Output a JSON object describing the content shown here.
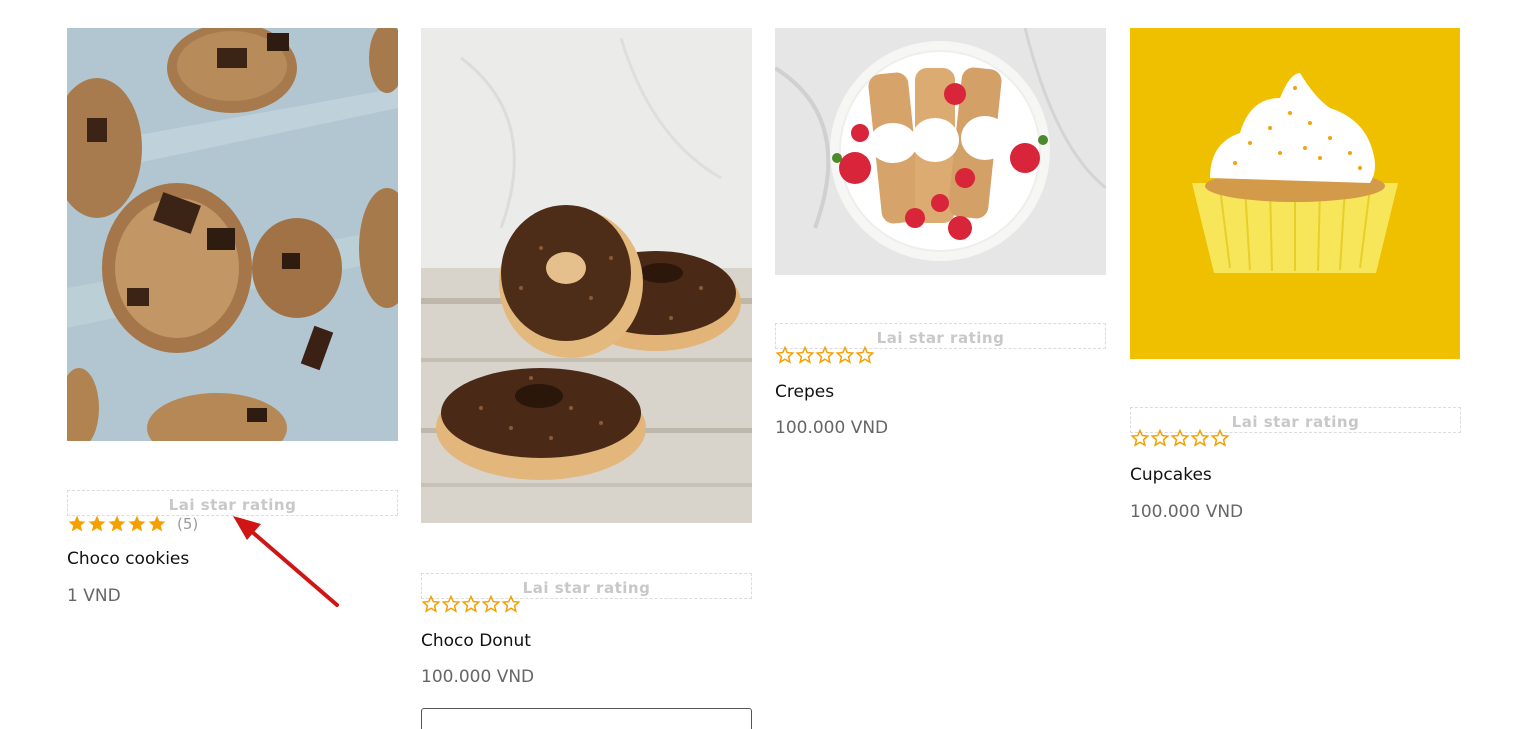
{
  "products": [
    {
      "image_alt": "chocolate chip cookies on parchment",
      "rating_label": "Lai star rating",
      "filled_stars": 5,
      "total_stars": 5,
      "count": "(5)",
      "title": "Choco cookies",
      "price": "1 VND"
    },
    {
      "image_alt": "chocolate sprinkle donuts stacked",
      "rating_label": "Lai star rating",
      "filled_stars": 0,
      "total_stars": 5,
      "count": "",
      "title": "Choco Donut",
      "price": "100.000 VND"
    },
    {
      "image_alt": "crepes with strawberries and cream",
      "rating_label": "Lai star rating",
      "filled_stars": 0,
      "total_stars": 5,
      "count": "",
      "title": "Crepes",
      "price": "100.000 VND"
    },
    {
      "image_alt": "cupcake with white frosting on yellow",
      "rating_label": "Lai star rating",
      "filled_stars": 0,
      "total_stars": 5,
      "count": "",
      "title": "Cupcakes",
      "price": "100.000 VND"
    }
  ],
  "colors": {
    "star": "#f5a000",
    "arrow": "#d01515",
    "title": "#111111",
    "price": "#666666"
  }
}
